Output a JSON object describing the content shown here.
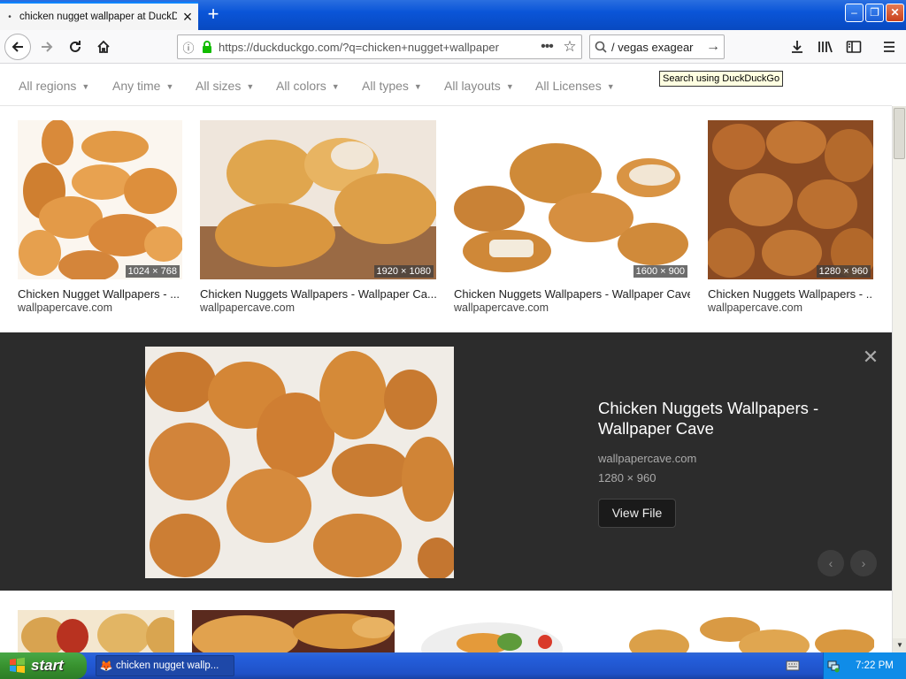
{
  "browser": {
    "tab_title": "chicken nugget wallpaper at DuckD",
    "tab_dot": "•",
    "url": "https://duckduckgo.com/?q=chicken+nugget+wallpaper",
    "search_query": "/ vegas exagear",
    "tooltip": "Search using DuckDuckGo",
    "window_buttons": {
      "minimize": "–",
      "maximize": "❐",
      "close": "✕"
    }
  },
  "filters": [
    {
      "label": "All regions"
    },
    {
      "label": "Any time"
    },
    {
      "label": "All sizes"
    },
    {
      "label": "All colors"
    },
    {
      "label": "All types"
    },
    {
      "label": "All layouts"
    },
    {
      "label": "All Licenses"
    }
  ],
  "results": [
    {
      "caption": "Chicken Nugget Wallpapers - ...",
      "source": "wallpapercave.com",
      "dims": "1024 × 768"
    },
    {
      "caption": "Chicken Nuggets Wallpapers - Wallpaper Ca...",
      "source": "wallpapercave.com",
      "dims": "1920 × 1080"
    },
    {
      "caption": "Chicken Nuggets Wallpapers - Wallpaper Cave",
      "source": "wallpapercave.com",
      "dims": "1600 × 900"
    },
    {
      "caption": "Chicken Nuggets Wallpapers - ...",
      "source": "wallpapercave.com",
      "dims": "1280 × 960"
    }
  ],
  "detail": {
    "title": "Chicken Nuggets Wallpapers - Wallpaper Cave",
    "source": "wallpapercave.com",
    "dims": "1280 × 960",
    "view_file": "View File",
    "close": "✕",
    "prev": "‹",
    "next": "›"
  },
  "taskbar": {
    "start_label": "start",
    "task_label": "chicken nugget wallp...",
    "clock": "7:22 PM"
  },
  "colors": {
    "detail_bg": "#2c2c2c",
    "xp_blue": "#245edb",
    "start_green": "#38922f"
  }
}
